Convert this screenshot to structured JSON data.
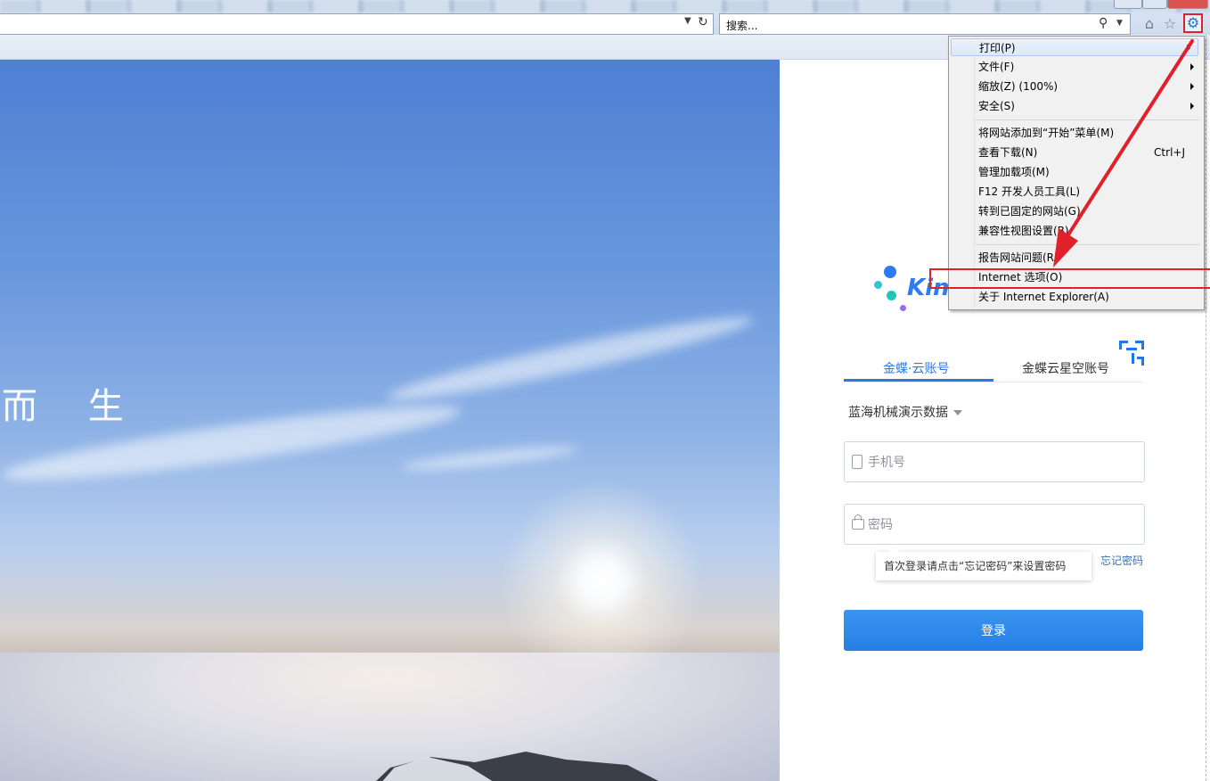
{
  "browser": {
    "search_placeholder": "搜索...",
    "icons": [
      "dropdown-icon",
      "refresh-icon",
      "search-icon",
      "home-icon",
      "favorites-star-icon",
      "tools-gear-icon"
    ]
  },
  "hero": {
    "slogan": "而 生"
  },
  "login": {
    "logo_text": "Kin",
    "tabs": [
      "金蝶·云账号",
      "金蝶云星空账号"
    ],
    "org_select": "蓝海机械演示数据",
    "phone_placeholder": "手机号",
    "password_placeholder": "密码",
    "forgot_link": "忘记密码",
    "tip": "首次登录请点击“忘记密码”来设置密码",
    "login_button": "登录",
    "accent_color": "#2a7ae0"
  },
  "tools_menu": {
    "items": [
      {
        "label": "打印(P)",
        "submenu": true
      },
      {
        "label": "文件(F)",
        "submenu": true
      },
      {
        "label": "缩放(Z) (100%)",
        "submenu": true
      },
      {
        "label": "安全(S)",
        "submenu": true
      },
      {
        "label": "将网站添加到“开始”菜单(M)"
      },
      {
        "label": "查看下载(N)",
        "shortcut": "Ctrl+J"
      },
      {
        "label": "管理加载项(M)"
      },
      {
        "label": "F12 开发人员工具(L)"
      },
      {
        "label": "转到已固定的网站(G)"
      },
      {
        "label": "兼容性视图设置(B)"
      },
      {
        "label": "报告网站问题(R)"
      },
      {
        "label": "Internet 选项(O)"
      },
      {
        "label": "关于 Internet Explorer(A)"
      }
    ],
    "highlight_color": "#e0202a"
  }
}
